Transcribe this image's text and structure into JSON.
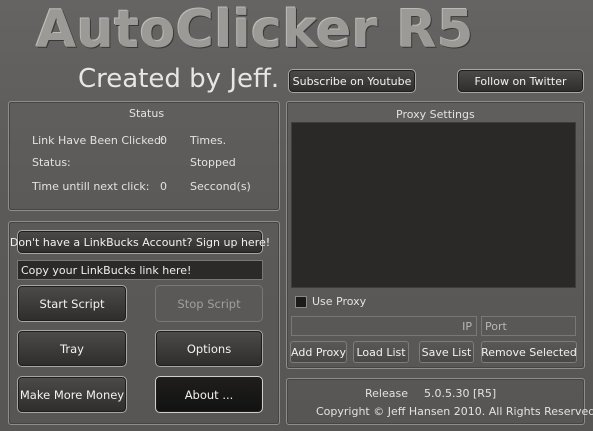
{
  "header": {
    "title": "AutoClicker R5",
    "subtitle": "Created by Jeff.",
    "subscribe_button": "Subscribe on Youtube",
    "twitter_button": "Follow on Twitter"
  },
  "status": {
    "title": "Status",
    "clicked_label": "Link Have Been Clicked:",
    "clicked_value": "0",
    "clicked_unit": "Times.",
    "status_label": "Status:",
    "status_value": "Stopped",
    "next_label": "Time untill next click:",
    "next_value": "0",
    "next_unit": "Seccond(s)"
  },
  "controls": {
    "signup_button": "Don't have a LinkBucks Account? Sign up here!",
    "link_input_value": "Copy your LinkBucks link here!",
    "start_button": "Start Script",
    "stop_button": "Stop Script",
    "tray_button": "Tray",
    "options_button": "Options",
    "money_button": "Make More Money",
    "about_button": "About ..."
  },
  "proxy": {
    "title": "Proxy Settings",
    "use_proxy_label": "Use Proxy",
    "ip_placeholder": "IP",
    "port_placeholder": "Port",
    "add_button": "Add Proxy",
    "load_button": "Load List",
    "save_button": "Save List",
    "remove_button": "Remove Selected"
  },
  "footer": {
    "release_label": "Release",
    "release_value": "5.0.5.30 [R5]",
    "copyright": "Copyright © Jeff Hansen 2010. All Rights Reserved."
  },
  "colors": {
    "background": "#5f5d5b",
    "button_dark": "#1f1e1d",
    "list_background": "#2b2a29"
  }
}
